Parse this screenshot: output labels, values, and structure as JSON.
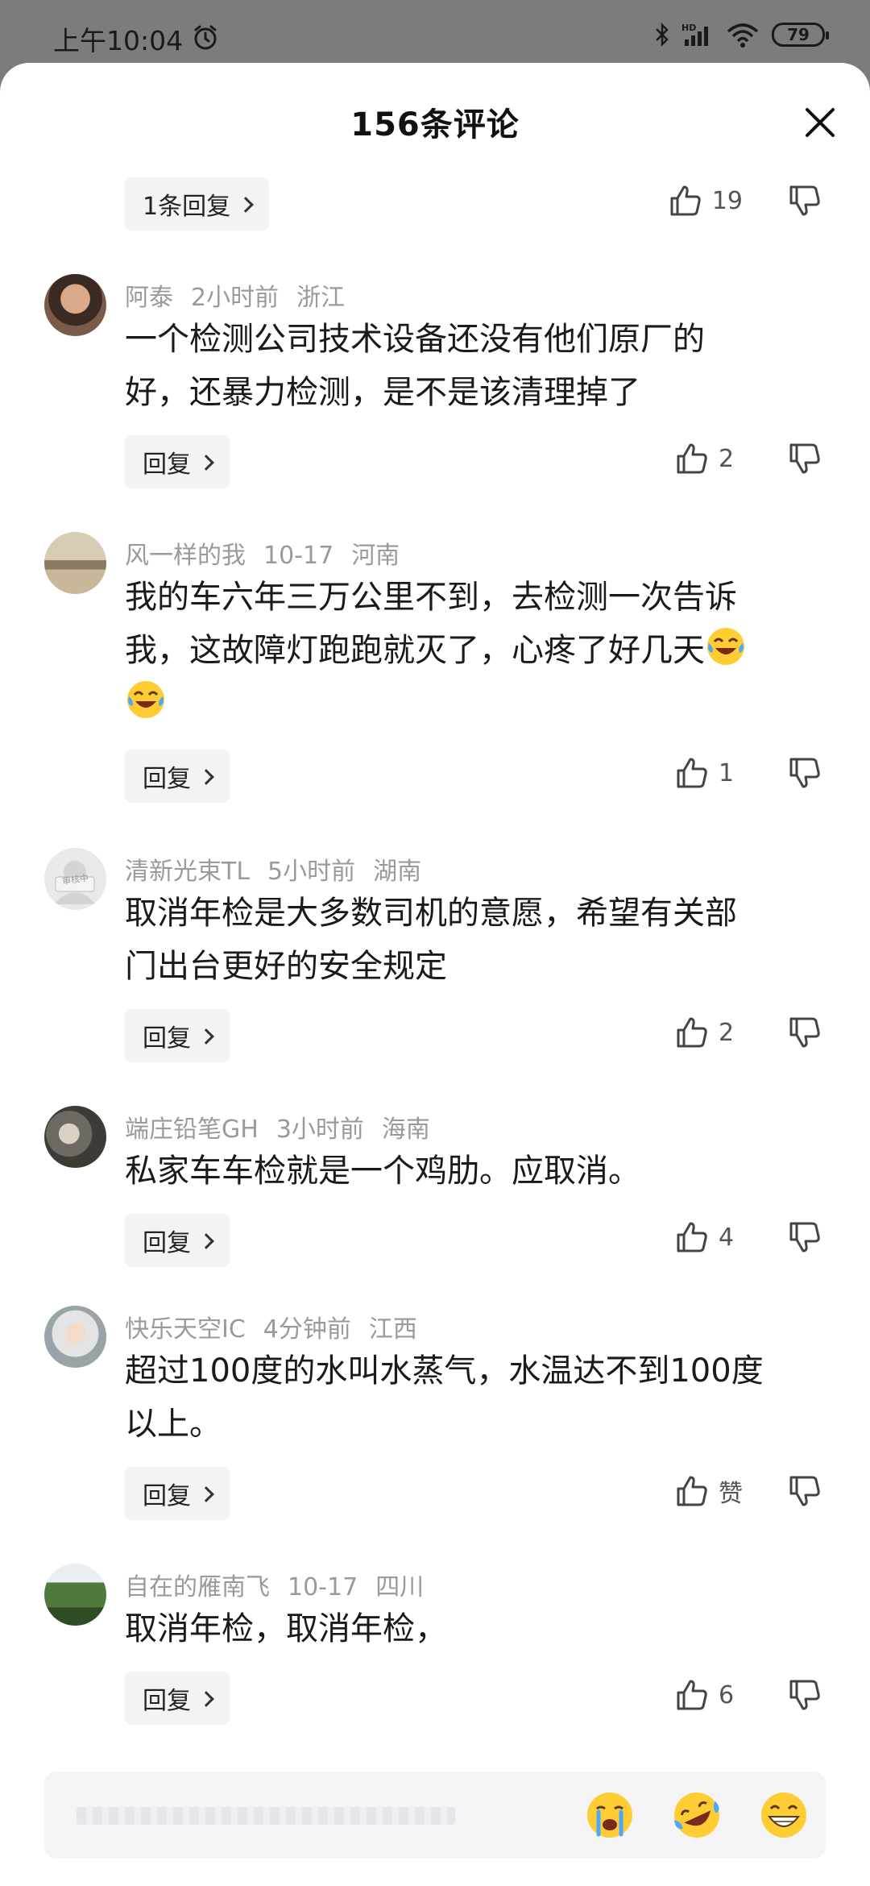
{
  "status_bar": {
    "time": "上午10:04",
    "battery": "79"
  },
  "sheet": {
    "title": "156条评论"
  },
  "top_reply": {
    "label": "1条回复",
    "likes": "19"
  },
  "comments": [
    {
      "name": "阿泰",
      "time": "2小时前",
      "region": "浙江",
      "lines": [
        "一个检测公司技术设备还没有他们原厂的",
        "好，还暴力检测，是不是该清理掉了"
      ],
      "reply_label": "回复",
      "likes": "2"
    },
    {
      "name": "风一样的我",
      "time": "10-17",
      "region": "河南",
      "lines": [
        "我的车六年三万公里不到，去检测一次告诉",
        "我，这故障灯跑跑就灭了，心疼了好几天"
      ],
      "reply_label": "回复",
      "likes": "1"
    },
    {
      "name": "清新光束TL",
      "time": "5小时前",
      "region": "湖南",
      "lines": [
        "取消年检是大多数司机的意愿，希望有关部",
        "门出台更好的安全规定"
      ],
      "reply_label": "回复",
      "likes": "2",
      "avatar_badge": "审核中"
    },
    {
      "name": "端庄铅笔GH",
      "time": "3小时前",
      "region": "海南",
      "lines": [
        "私家车车检就是一个鸡肋。应取消。"
      ],
      "reply_label": "回复",
      "likes": "4"
    },
    {
      "name": "快乐天空IC",
      "time": "4分钟前",
      "region": "江西",
      "lines": [
        "超过100度的水叫水蒸气，水温达不到100度",
        "以上。"
      ],
      "reply_label": "回复",
      "likes": "赞"
    },
    {
      "name": "自在的雁南飞",
      "time": "10-17",
      "region": "四川",
      "lines": [
        "取消年检，取消年检，"
      ],
      "reply_label": "回复",
      "likes": "6"
    }
  ],
  "icons": {
    "close": "close-icon",
    "like": "thumbs-up-icon",
    "dislike": "thumbs-down-icon",
    "alarm": "alarm-clock-icon",
    "bluetooth": "bluetooth-icon",
    "signal": "signal-icon",
    "wifi": "wifi-icon"
  },
  "colors": {
    "meta_text": "#9a9a9a",
    "pill_bg": "#f3f3f3",
    "input_bg": "#f4f4f6"
  }
}
